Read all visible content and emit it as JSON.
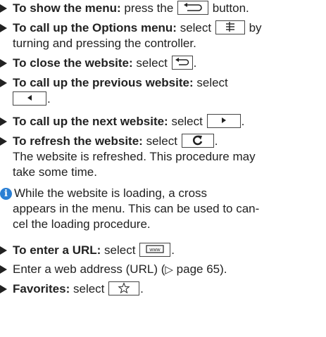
{
  "items": {
    "show_menu": {
      "bold": "To show the menu:",
      "pre": "press the",
      "post": "button."
    },
    "options_menu": {
      "bold": "To call up the Options menu:",
      "pre": "select",
      "post": "by",
      "cont": "turning and pressing the controller."
    },
    "close_website": {
      "bold": "To close the website:",
      "pre": "select",
      "post": "."
    },
    "previous_website": {
      "bold": "To call up the previous website:",
      "pre": "select",
      "post": "."
    },
    "next_website": {
      "bold": "To call up the next website:",
      "pre": "select",
      "post": "."
    },
    "refresh_website": {
      "bold": "To refresh the website:",
      "pre": "select",
      "post": ".",
      "cont1": "The website is refreshed. This procedure may",
      "cont2": "take some time."
    },
    "note": {
      "icon": "i",
      "line1": "While the website is loading, a cross",
      "line2": "appears in the menu. This can be used to can-",
      "line3": "cel the loading procedure."
    },
    "enter_url": {
      "bold": "To enter a URL:",
      "pre": "select",
      "post": ".",
      "button_text": "www"
    },
    "web_address": {
      "text": "Enter a web address (URL) (",
      "symbol": "▷",
      "page_ref": "page 65",
      "close": ")."
    },
    "favorites": {
      "bold": "Favorites:",
      "pre": "select",
      "post": "."
    }
  },
  "icons": {
    "bullet": "arrow-bullet-icon",
    "back": "back-arrow-icon",
    "options": "options-list-icon",
    "close": "close-back-icon",
    "previous": "triangle-left-icon",
    "next": "triangle-right-icon",
    "refresh": "refresh-icon",
    "url": "www-icon",
    "favorites": "star-icon",
    "info": "info-icon"
  },
  "colors": {
    "text": "#222222",
    "info_icon": "#2a7fd4"
  }
}
